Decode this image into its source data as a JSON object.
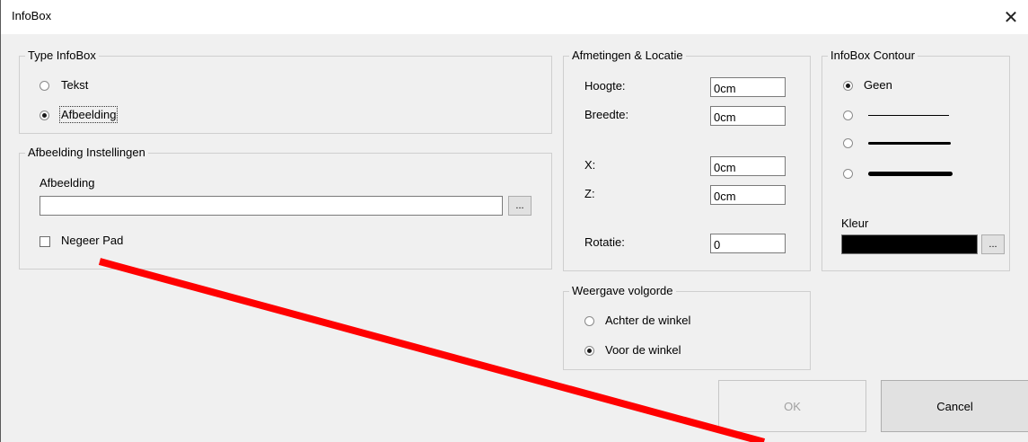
{
  "window": {
    "title": "InfoBox",
    "close_glyph": "✕"
  },
  "type_group": {
    "legend": "Type InfoBox",
    "options": [
      {
        "label": "Tekst",
        "selected": false
      },
      {
        "label": "Afbeelding",
        "selected": true
      }
    ]
  },
  "image_group": {
    "legend": "Afbeelding Instellingen",
    "field_label": "Afbeelding",
    "field_value": "",
    "browse_label": "...",
    "checkbox_label": "Negeer Pad",
    "checkbox_checked": false
  },
  "size_group": {
    "legend": "Afmetingen & Locatie",
    "height_label": "Hoogte:",
    "height_value": "0cm",
    "width_label": "Breedte:",
    "width_value": "0cm",
    "x_label": "X:",
    "x_value": "0cm",
    "z_label": "Z:",
    "z_value": "0cm",
    "rotation_label": "Rotatie:",
    "rotation_value": "0"
  },
  "contour_group": {
    "legend": "InfoBox Contour",
    "options": [
      {
        "label": "Geen",
        "selected": true,
        "line": "none"
      },
      {
        "label": "",
        "selected": false,
        "line": "thin"
      },
      {
        "label": "",
        "selected": false,
        "line": "medium"
      },
      {
        "label": "",
        "selected": false,
        "line": "thick"
      }
    ],
    "color_label": "Kleur",
    "color_value": "#000000",
    "color_browse_label": "..."
  },
  "order_group": {
    "legend": "Weergave volgorde",
    "options": [
      {
        "label": "Achter de winkel",
        "selected": false
      },
      {
        "label": "Voor de winkel",
        "selected": true
      }
    ]
  },
  "buttons": {
    "ok_label": "OK",
    "ok_enabled": false,
    "cancel_label": "Cancel"
  },
  "annotation": {
    "color": "#ff0000",
    "shape": "arrow-line"
  }
}
